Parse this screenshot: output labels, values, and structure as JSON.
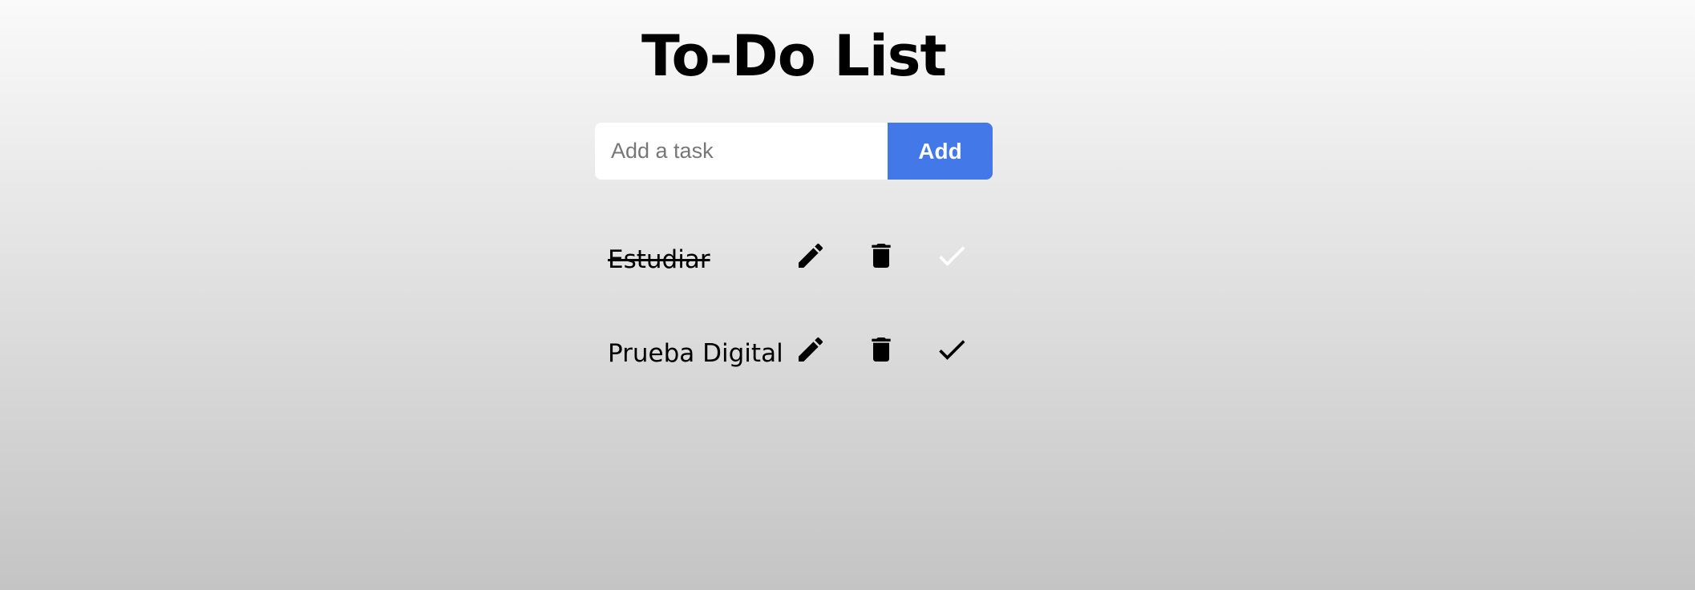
{
  "header": {
    "title": "To-Do List"
  },
  "form": {
    "placeholder": "Add a task",
    "value": "",
    "add_label": "Add"
  },
  "tasks": [
    {
      "text": "Estudiar",
      "completed": true
    },
    {
      "text": "Prueba Digital",
      "completed": false
    }
  ],
  "icons": {
    "edit": "pencil-icon",
    "delete": "trash-icon",
    "complete": "check-icon"
  },
  "colors": {
    "accent": "#4378e8",
    "background_top": "#fafafa",
    "background_bottom": "#c4c4c4",
    "check_completed": "#ffffff",
    "check_pending": "#000000"
  }
}
